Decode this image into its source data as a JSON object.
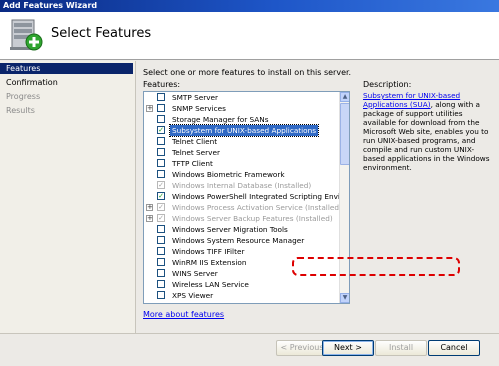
{
  "window": {
    "title": "Add Features Wizard"
  },
  "header": {
    "title": "Select Features",
    "icon": "server-features-icon"
  },
  "nav": {
    "items": [
      {
        "label": "Features",
        "state": "active"
      },
      {
        "label": "Confirmation",
        "state": "normal"
      },
      {
        "label": "Progress",
        "state": "dim"
      },
      {
        "label": "Results",
        "state": "dim"
      }
    ]
  },
  "main": {
    "instruction": "Select one or more features to install on this server.",
    "features_label": "Features:",
    "features": [
      {
        "label": "SMTP Server",
        "checked": false,
        "expander": false,
        "installed": false,
        "selected": false
      },
      {
        "label": "SNMP Services",
        "checked": false,
        "expander": true,
        "installed": false,
        "selected": false
      },
      {
        "label": "Storage Manager for SANs",
        "checked": false,
        "expander": false,
        "installed": false,
        "selected": false
      },
      {
        "label": "Subsystem for UNIX-based Applications",
        "checked": true,
        "expander": false,
        "installed": false,
        "selected": true
      },
      {
        "label": "Telnet Client",
        "checked": false,
        "expander": false,
        "installed": false,
        "selected": false
      },
      {
        "label": "Telnet Server",
        "checked": false,
        "expander": false,
        "installed": false,
        "selected": false
      },
      {
        "label": "TFTP Client",
        "checked": false,
        "expander": false,
        "installed": false,
        "selected": false
      },
      {
        "label": "Windows Biometric Framework",
        "checked": false,
        "expander": false,
        "installed": false,
        "selected": false
      },
      {
        "label": "Windows Internal Database  (Installed)",
        "checked": true,
        "expander": false,
        "installed": true,
        "selected": false
      },
      {
        "label": "Windows PowerShell Integrated Scripting Environment (IS",
        "checked": true,
        "expander": false,
        "installed": false,
        "selected": false
      },
      {
        "label": "Windows Process Activation Service  (Installed)",
        "checked": true,
        "expander": true,
        "installed": true,
        "selected": false
      },
      {
        "label": "Windows Server Backup Features  (Installed)",
        "checked": true,
        "expander": true,
        "installed": true,
        "selected": false
      },
      {
        "label": "Windows Server Migration Tools",
        "checked": false,
        "expander": false,
        "installed": false,
        "selected": false
      },
      {
        "label": "Windows System Resource Manager",
        "checked": false,
        "expander": false,
        "installed": false,
        "selected": false
      },
      {
        "label": "Windows TIFF IFilter",
        "checked": false,
        "expander": false,
        "installed": false,
        "selected": false
      },
      {
        "label": "WinRM IIS Extension",
        "checked": false,
        "expander": false,
        "installed": false,
        "selected": false
      },
      {
        "label": "WINS Server",
        "checked": false,
        "expander": false,
        "installed": false,
        "selected": false
      },
      {
        "label": "Wireless LAN Service",
        "checked": false,
        "expander": false,
        "installed": false,
        "selected": false
      },
      {
        "label": "XPS Viewer",
        "checked": false,
        "expander": false,
        "installed": false,
        "selected": false
      }
    ],
    "description_label": "Description:",
    "description_link": "Subsystem for UNIX-based Applications (SUA)",
    "description_text": ", along with a package of support utilities available for download from the Microsoft Web site, enables you to run UNIX-based programs, and compile and run custom UNIX-based applications in the Windows environment.",
    "more_link": "More about features"
  },
  "buttons": {
    "previous": "< Previous",
    "next": "Next >",
    "install": "Install",
    "cancel": "Cancel"
  },
  "colors": {
    "titlebar": "#0a2a83",
    "nav_active": "#0a246a",
    "selection": "#316ac5",
    "annotation": "#dd0000",
    "link": "#0000ee"
  }
}
